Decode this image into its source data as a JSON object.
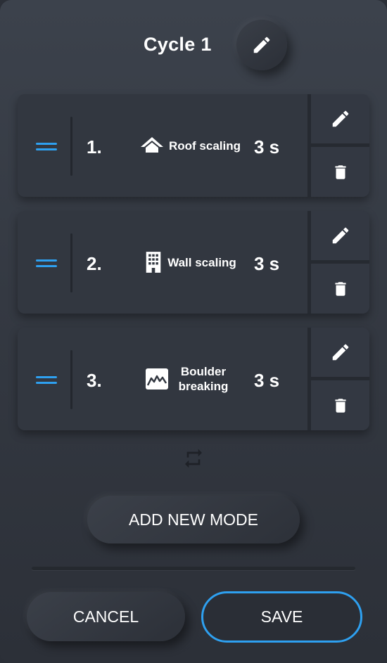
{
  "cycle": {
    "title": "Cycle 1"
  },
  "modes": [
    {
      "number": "1.",
      "name": "Roof scaling",
      "duration": "3 s",
      "icon": "roof-icon"
    },
    {
      "number": "2.",
      "name": "Wall scaling",
      "duration": "3 s",
      "icon": "building-icon"
    },
    {
      "number": "3.",
      "name": "Boulder breaking",
      "duration": "3 s",
      "icon": "boulder-icon"
    }
  ],
  "actions": {
    "add_label": "ADD NEW MODE",
    "cancel_label": "CANCEL",
    "save_label": "SAVE"
  },
  "colors": {
    "accent": "#2ea0f0",
    "text": "#ffffff",
    "background": "#343942"
  }
}
